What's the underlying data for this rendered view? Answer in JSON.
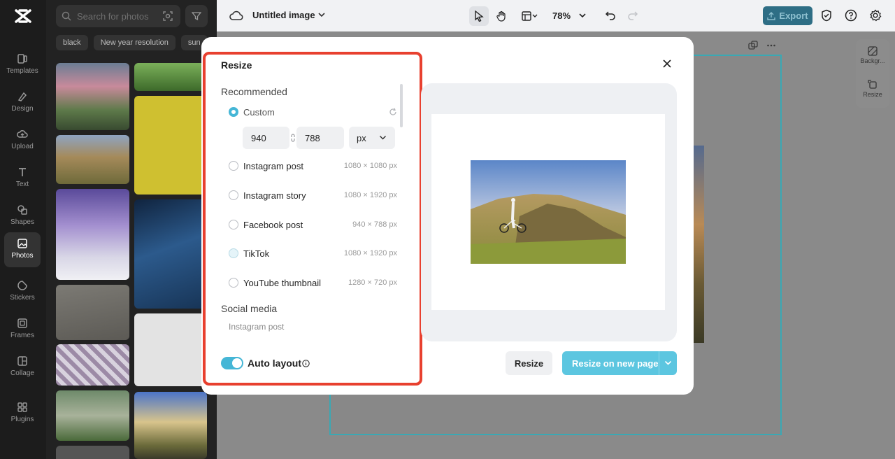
{
  "sidebar": {
    "items": [
      {
        "label": "Templates",
        "icon": "templates-icon"
      },
      {
        "label": "Design",
        "icon": "design-icon"
      },
      {
        "label": "Upload",
        "icon": "upload-icon"
      },
      {
        "label": "Text",
        "icon": "text-icon"
      },
      {
        "label": "Shapes",
        "icon": "shapes-icon"
      },
      {
        "label": "Photos",
        "icon": "photos-icon",
        "active": true
      },
      {
        "label": "Stickers",
        "icon": "stickers-icon"
      },
      {
        "label": "Frames",
        "icon": "frames-icon"
      },
      {
        "label": "Collage",
        "icon": "collage-icon"
      },
      {
        "label": "Plugins",
        "icon": "plugins-icon"
      }
    ]
  },
  "photos_panel": {
    "search_placeholder": "Search for photos",
    "chips": [
      "black",
      "New year resolution",
      "sun"
    ]
  },
  "topbar": {
    "doc_title": "Untitled image",
    "zoom": "78%",
    "export_label": "Export"
  },
  "right_tools": {
    "background_label": "Backgr...",
    "resize_label": "Resize"
  },
  "modal": {
    "title": "Resize",
    "recommended_title": "Recommended",
    "custom": {
      "label": "Custom",
      "width": "940",
      "height": "788",
      "unit": "px"
    },
    "options": [
      {
        "label": "Instagram post",
        "dims": "1080 × 1080 px"
      },
      {
        "label": "Instagram story",
        "dims": "1080 × 1920 px"
      },
      {
        "label": "Facebook post",
        "dims": "940 × 788 px"
      },
      {
        "label": "TikTok",
        "dims": "1080 × 1920 px"
      },
      {
        "label": "YouTube thumbnail",
        "dims": "1280 × 720 px"
      }
    ],
    "social_media_title": "Social media",
    "social_media_first": "Instagram post",
    "auto_layout_label": "Auto layout",
    "auto_layout_on": true,
    "resize_button": "Resize",
    "resize_new_page_button": "Resize on new page"
  },
  "colors": {
    "accent": "#45b6d6",
    "highlight": "#e8402f",
    "export_bg": "#2e6e85"
  }
}
